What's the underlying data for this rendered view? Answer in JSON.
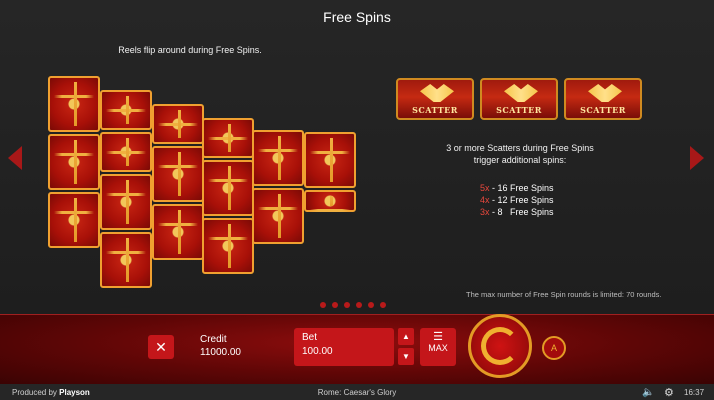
{
  "title": "Free Spins",
  "reels_caption": "Reels flip around during Free Spins.",
  "scatter": {
    "label": "SCATTER",
    "count_shown": 3
  },
  "info": {
    "line1": "3 or more Scatters during Free Spins",
    "line2": "trigger additional spins:"
  },
  "free_spins": [
    {
      "mult": "5x",
      "text": " - 16 Free Spins"
    },
    {
      "mult": "4x",
      "text": " - 12 Free Spins"
    },
    {
      "mult": "3x",
      "text": " - 8   Free Spins"
    }
  ],
  "limit_note": "The max number of Free Spin rounds is limited: 70 rounds.",
  "pagination": {
    "pages": 6
  },
  "panel": {
    "close_symbol": "✕",
    "credit_label": "Credit",
    "credit_value": "11000.00",
    "bet_label": "Bet",
    "bet_value": "100.00",
    "bet_up": "▲",
    "bet_down": "▼",
    "max_label": "MAX",
    "max_icon": "coin-stack-icon",
    "spin_icon": "spin-arrow-icon",
    "auto_icon": "autoplay-icon",
    "auto_symbol": "A"
  },
  "footer": {
    "produced_prefix": "Produced by ",
    "brand": "Playson",
    "game_name": "Rome: Caesar's Glory",
    "time": "16:37",
    "sound_icon": "speaker-icon",
    "settings_icon": "gear-icon"
  },
  "colors": {
    "accent_red": "#c4161a",
    "gold": "#e39b25",
    "multiplier": "#e8473c"
  }
}
